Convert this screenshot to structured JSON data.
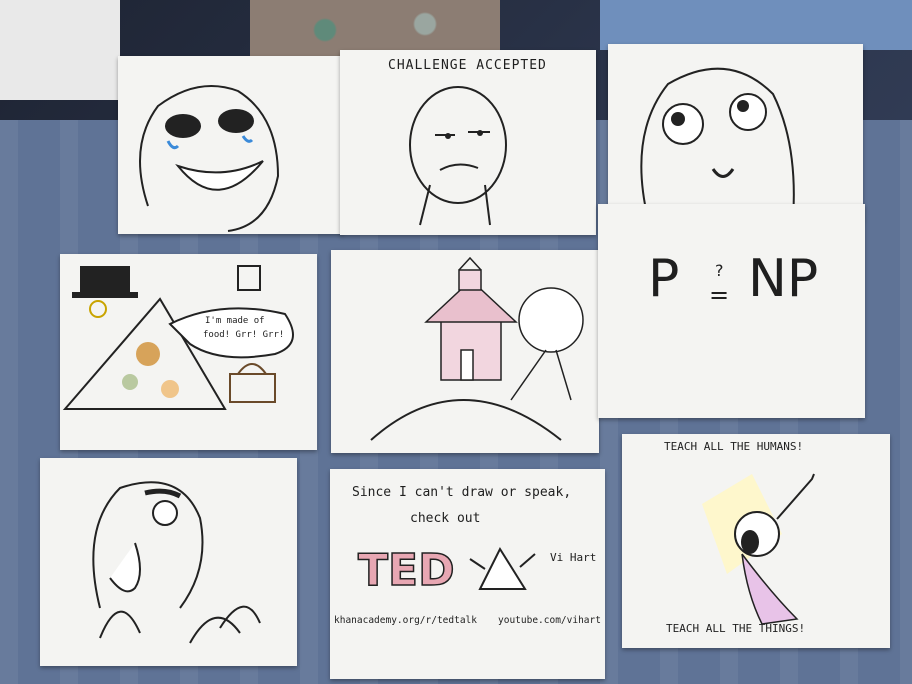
{
  "papers": {
    "challenge_caption": "CHALLENGE ACCEPTED",
    "p_np": {
      "p": "P",
      "sym": "?",
      "np": "NP"
    },
    "speech_line1": "I'm made of",
    "speech_line2": "food! Grr! Grr!",
    "teach_top": "TEACH ALL THE HUMANS!",
    "teach_bottom": "TEACH ALL THE THINGS!",
    "since_line1": "Since I can't draw or speak,",
    "since_line2": "check out",
    "ted": "TED",
    "vi_hart": "Vi Hart",
    "khan_url": "khanacademy.org/r/tedtalk",
    "youtube_url": "youtube.com/vihart"
  }
}
